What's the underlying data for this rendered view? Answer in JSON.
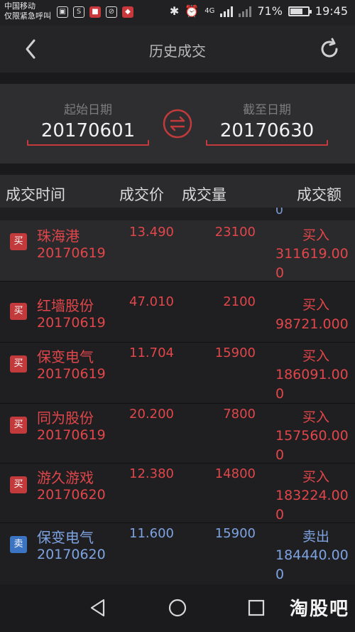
{
  "status_bar": {
    "carrier_line1": "中国移动",
    "carrier_line2": "仅限紧急呼叫",
    "network": "4G",
    "battery": "71%",
    "battery_level": 0.71,
    "time": "19:45"
  },
  "header": {
    "title": "历史成交",
    "back_icon": "chevron-left-icon",
    "refresh_icon": "refresh-icon"
  },
  "date_range": {
    "start_label": "起始日期",
    "start_value": "20170601",
    "end_label": "截至日期",
    "end_value": "20170630",
    "swap_icon": "swap-arrows-icon"
  },
  "table": {
    "columns": {
      "time": "成交时间",
      "price": "成交价",
      "volume": "成交量",
      "amount": "成交额"
    },
    "partial_row_tail": "0",
    "rows": [
      {
        "tag": "买",
        "name": "珠海港",
        "date": "20170619",
        "price": "13.490",
        "volume": "23100",
        "side": "买入",
        "amount": "311619.000"
      },
      {
        "tag": "买",
        "name": "红墙股份",
        "date": "20170619",
        "price": "47.010",
        "volume": "2100",
        "side": "买入",
        "amount": "98721.000"
      },
      {
        "tag": "买",
        "name": "保变电气",
        "date": "20170619",
        "price": "11.704",
        "volume": "15900",
        "side": "买入",
        "amount": "186091.000"
      },
      {
        "tag": "买",
        "name": "同为股份",
        "date": "20170619",
        "price": "20.200",
        "volume": "7800",
        "side": "买入",
        "amount": "157560.000"
      },
      {
        "tag": "买",
        "name": "游久游戏",
        "date": "20170620",
        "price": "12.380",
        "volume": "14800",
        "side": "买入",
        "amount": "183224.000"
      },
      {
        "tag": "卖",
        "name": "保变电气",
        "date": "20170620",
        "price": "11.600",
        "volume": "15900",
        "side": "卖出",
        "amount": "184440.000"
      }
    ]
  },
  "colors": {
    "buy": "#e0464a",
    "sell": "#7ea3e2",
    "accent": "#c23a3c"
  },
  "watermark": "淘股吧"
}
